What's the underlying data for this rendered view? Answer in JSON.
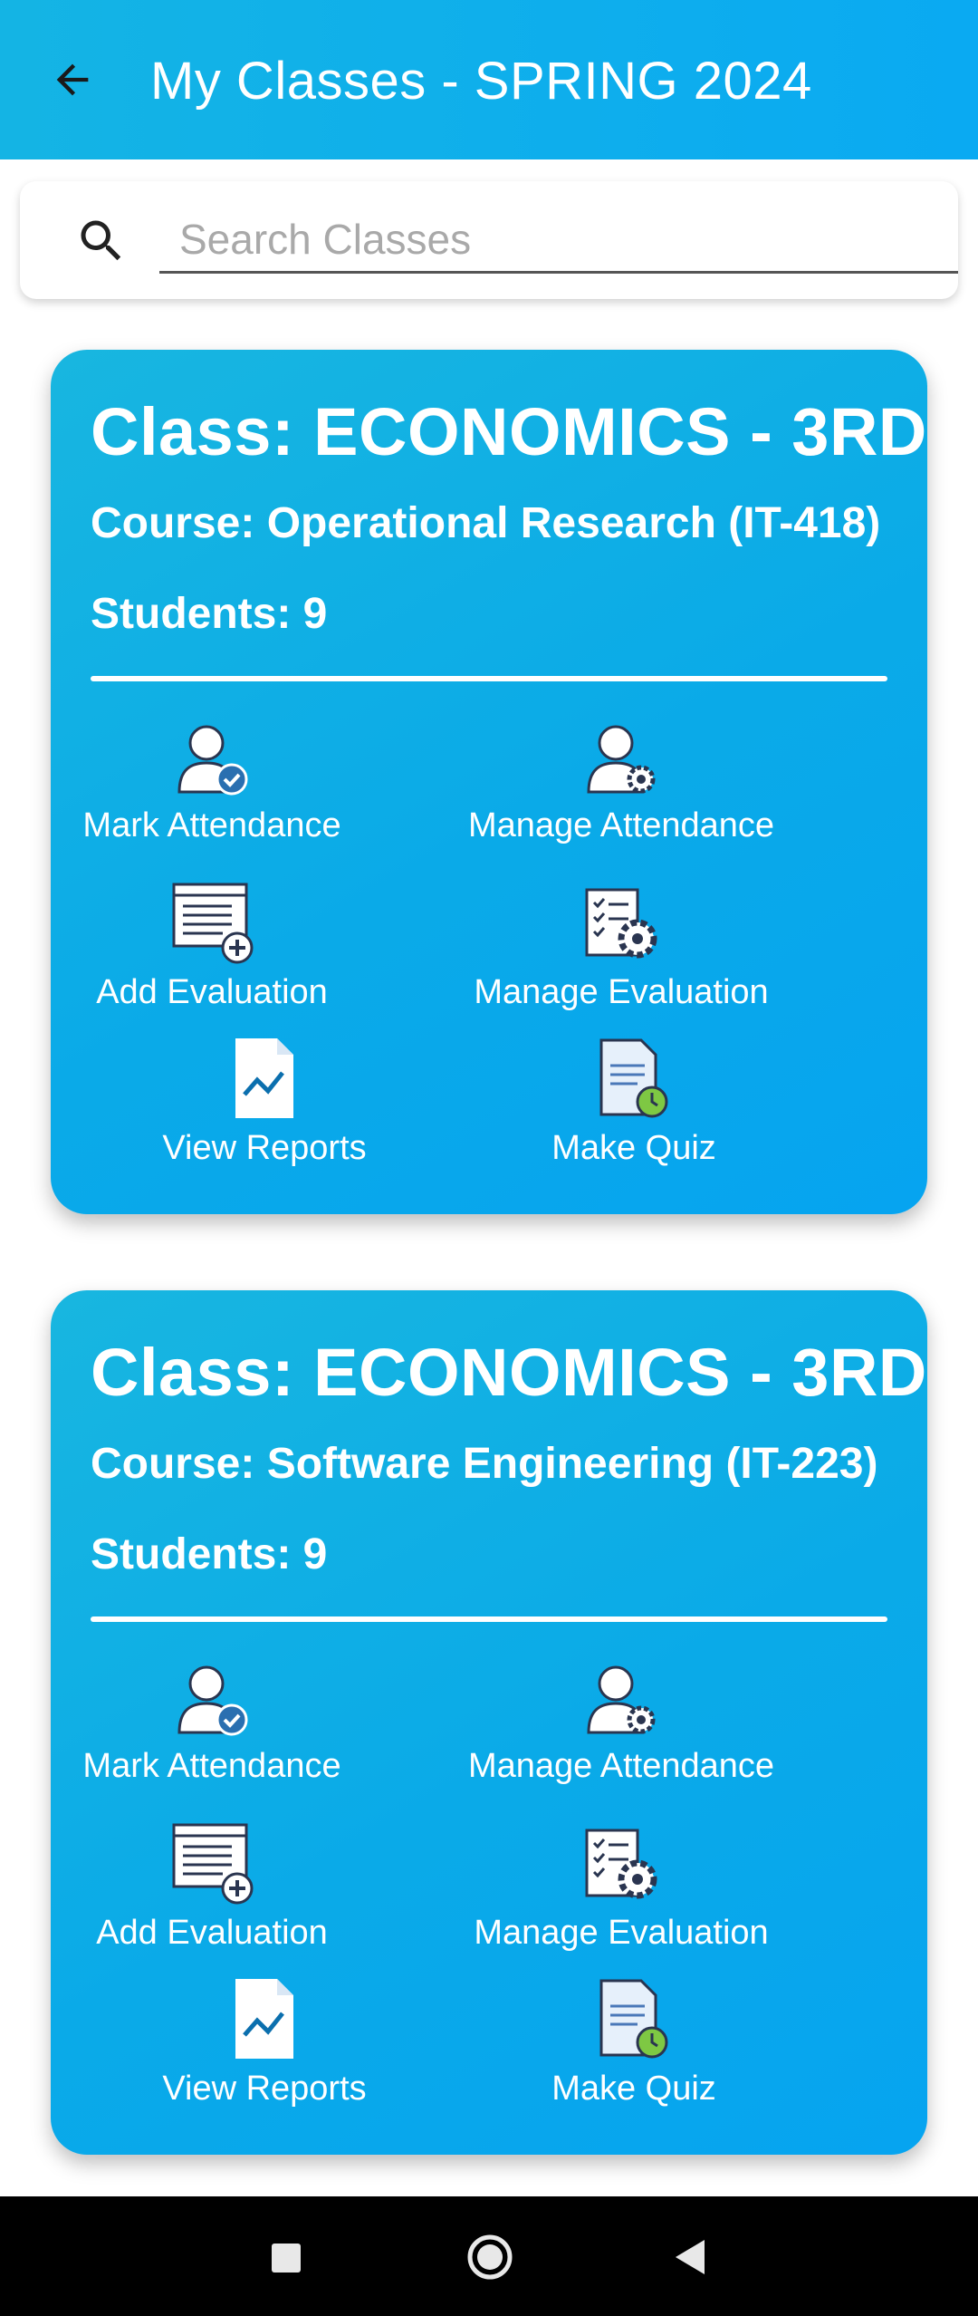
{
  "appbar": {
    "title": "My Classes - SPRING 2024"
  },
  "search": {
    "placeholder": "Search Classes"
  },
  "classes": [
    {
      "class_label": "Class: ECONOMICS - 3RD",
      "course_label": "Course: Operational Research (IT-418)",
      "students_label": "Students: 9",
      "actions": {
        "mark_attendance": "Mark Attendance",
        "manage_attendance": "Manage Attendance",
        "add_evaluation": "Add Evaluation",
        "manage_evaluation": "Manage Evaluation",
        "view_reports": "View Reports",
        "make_quiz": "Make Quiz"
      }
    },
    {
      "class_label": "Class: ECONOMICS - 3RD",
      "course_label": "Course: Software Engineering (IT-223)",
      "students_label": "Students: 9",
      "actions": {
        "mark_attendance": "Mark Attendance",
        "manage_attendance": "Manage Attendance",
        "add_evaluation": "Add Evaluation",
        "manage_evaluation": "Manage Evaluation",
        "view_reports": "View Reports",
        "make_quiz": "Make Quiz"
      }
    }
  ],
  "icons": {
    "back": "arrow-left-icon",
    "search": "search-icon",
    "mark_attendance": "user-check-icon",
    "manage_attendance": "user-gear-icon",
    "add_evaluation": "list-add-icon",
    "manage_evaluation": "document-gear-icon",
    "view_reports": "chart-document-icon",
    "make_quiz": "document-clock-icon"
  },
  "colors": {
    "appbar": "#0aaaf2",
    "card": "#0aaae8",
    "text_on_card": "#ffffff",
    "navbar": "#000000"
  }
}
